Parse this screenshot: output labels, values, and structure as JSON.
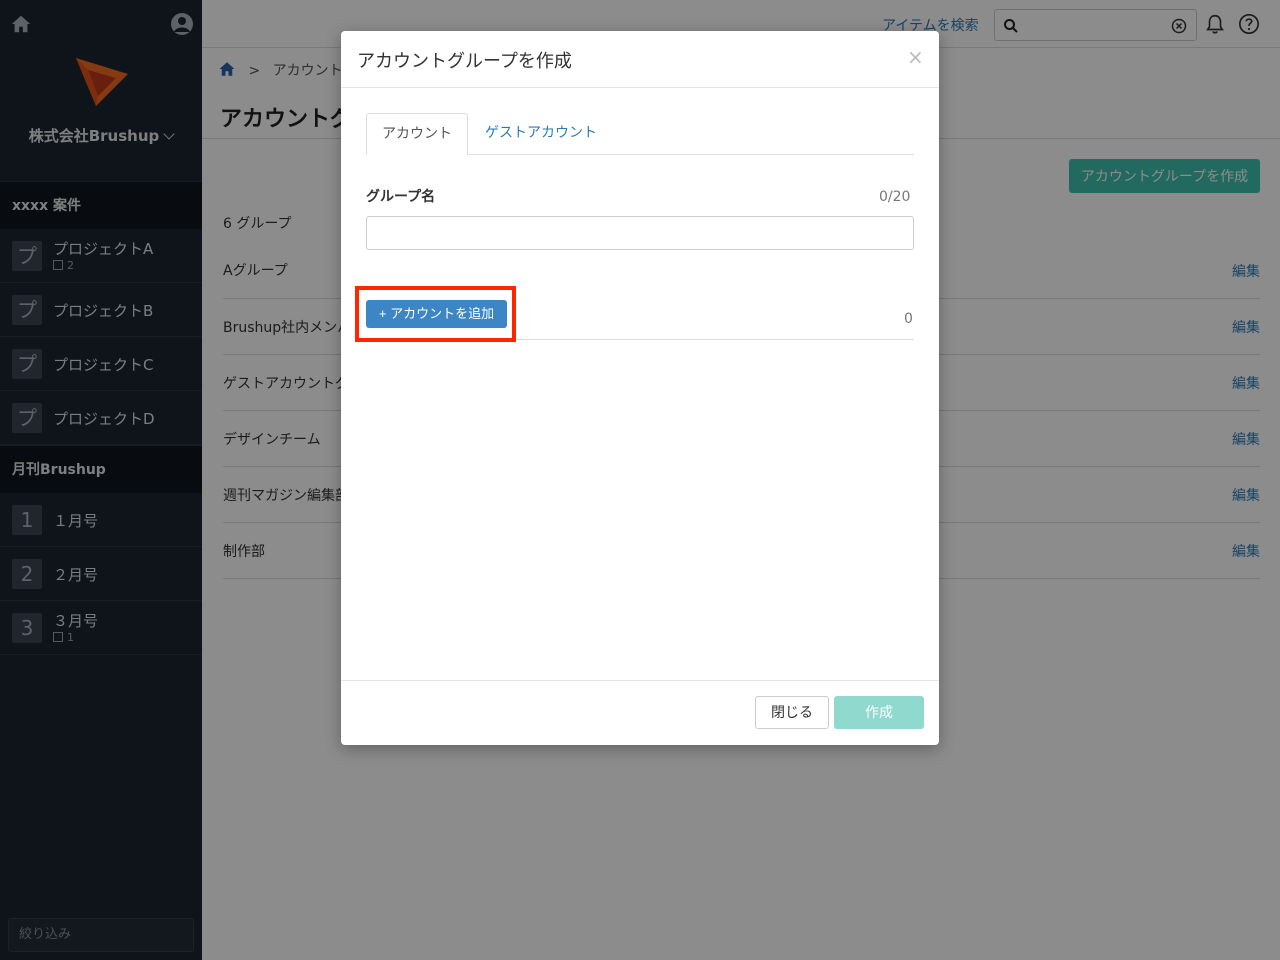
{
  "sidebar": {
    "company": "株式会社Brushup",
    "sections": [
      {
        "title": "xxxx 案件",
        "items": [
          {
            "badge": "プ",
            "label": "プロジェクトA",
            "sub": "2"
          },
          {
            "badge": "プ",
            "label": "プロジェクトB",
            "sub": ""
          },
          {
            "badge": "プ",
            "label": "プロジェクトC",
            "sub": ""
          },
          {
            "badge": "プ",
            "label": "プロジェクトD",
            "sub": ""
          }
        ]
      },
      {
        "title": "月刊Brushup",
        "items": [
          {
            "badge": "1",
            "label": "１月号",
            "sub": ""
          },
          {
            "badge": "2",
            "label": "２月号",
            "sub": ""
          },
          {
            "badge": "3",
            "label": "３月号",
            "sub": "1"
          }
        ]
      }
    ],
    "filter_placeholder": "絞り込み"
  },
  "header": {
    "item_search_link": "アイテムを検索",
    "search_value": ""
  },
  "breadcrumb": {
    "separator": ">",
    "current": "アカウントグ"
  },
  "page": {
    "title": "アカウントグ",
    "create_button": "アカウントグループを作成",
    "group_count": "6 グループ",
    "edit_label": "編集",
    "groups": [
      "Aグループ",
      "Brushup社内メンバ",
      "ゲストアカウントグ",
      "デザインチーム",
      "週刊マガジン編集部",
      "制作部"
    ]
  },
  "modal": {
    "title": "アカウントグループを作成",
    "close_symbol": "×",
    "tabs": [
      "アカウント",
      "ゲストアカウント"
    ],
    "group_name_label": "グループ名",
    "group_name_count": "0/20",
    "group_name_value": "",
    "add_account_button": "アカウントを追加",
    "add_account_icon": "+",
    "account_count": "0",
    "close_button": "閉じる",
    "create_button": "作成"
  },
  "colors": {
    "sidebar_bg": "#1c2330",
    "accent_teal": "#3fbfae",
    "link_blue": "#2b7bb9",
    "primary_blue": "#3d86c6",
    "highlight_red": "#ff2600"
  }
}
